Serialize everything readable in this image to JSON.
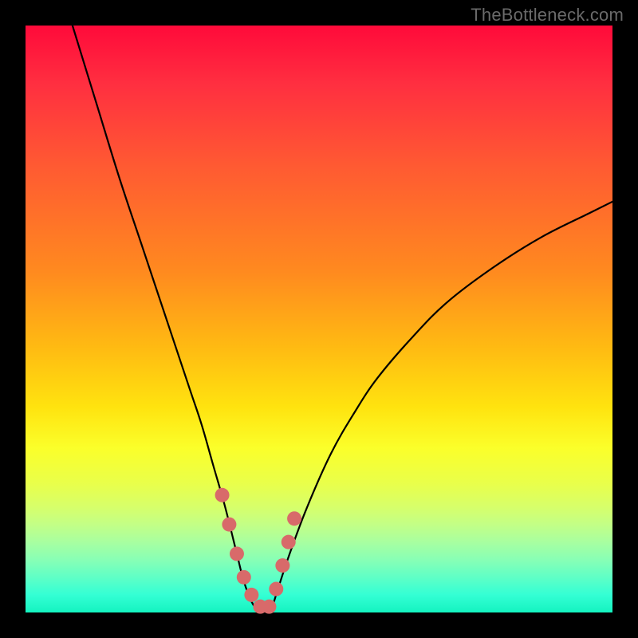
{
  "watermark": "TheBottleneck.com",
  "chart_data": {
    "type": "line",
    "title": "",
    "xlabel": "",
    "ylabel": "",
    "x_range": [
      0,
      100
    ],
    "y_range": [
      0,
      100
    ],
    "series": [
      {
        "name": "bottleneck-curve",
        "x": [
          8,
          12,
          16,
          20,
          24,
          28,
          30,
          32,
          34,
          36,
          37,
          38,
          39,
          40,
          41,
          42,
          43,
          45,
          48,
          52,
          56,
          60,
          66,
          72,
          80,
          88,
          96,
          100
        ],
        "y": [
          100,
          87,
          74,
          62,
          50,
          38,
          32,
          25,
          18,
          10,
          6,
          3,
          1,
          0,
          0,
          1,
          4,
          10,
          18,
          27,
          34,
          40,
          47,
          53,
          59,
          64,
          68,
          70
        ]
      }
    ],
    "markers": {
      "name": "highlight-dots",
      "color": "#d86a6a",
      "x": [
        33.5,
        34.7,
        36.0,
        37.2,
        38.5,
        40.0,
        41.5,
        42.7,
        43.8,
        44.8,
        45.8
      ],
      "y": [
        20,
        15,
        10,
        6,
        3,
        1,
        1,
        4,
        8,
        12,
        16
      ]
    },
    "background_gradient": {
      "top": "#ff0a3a",
      "bottom": "#14f3c0"
    }
  }
}
